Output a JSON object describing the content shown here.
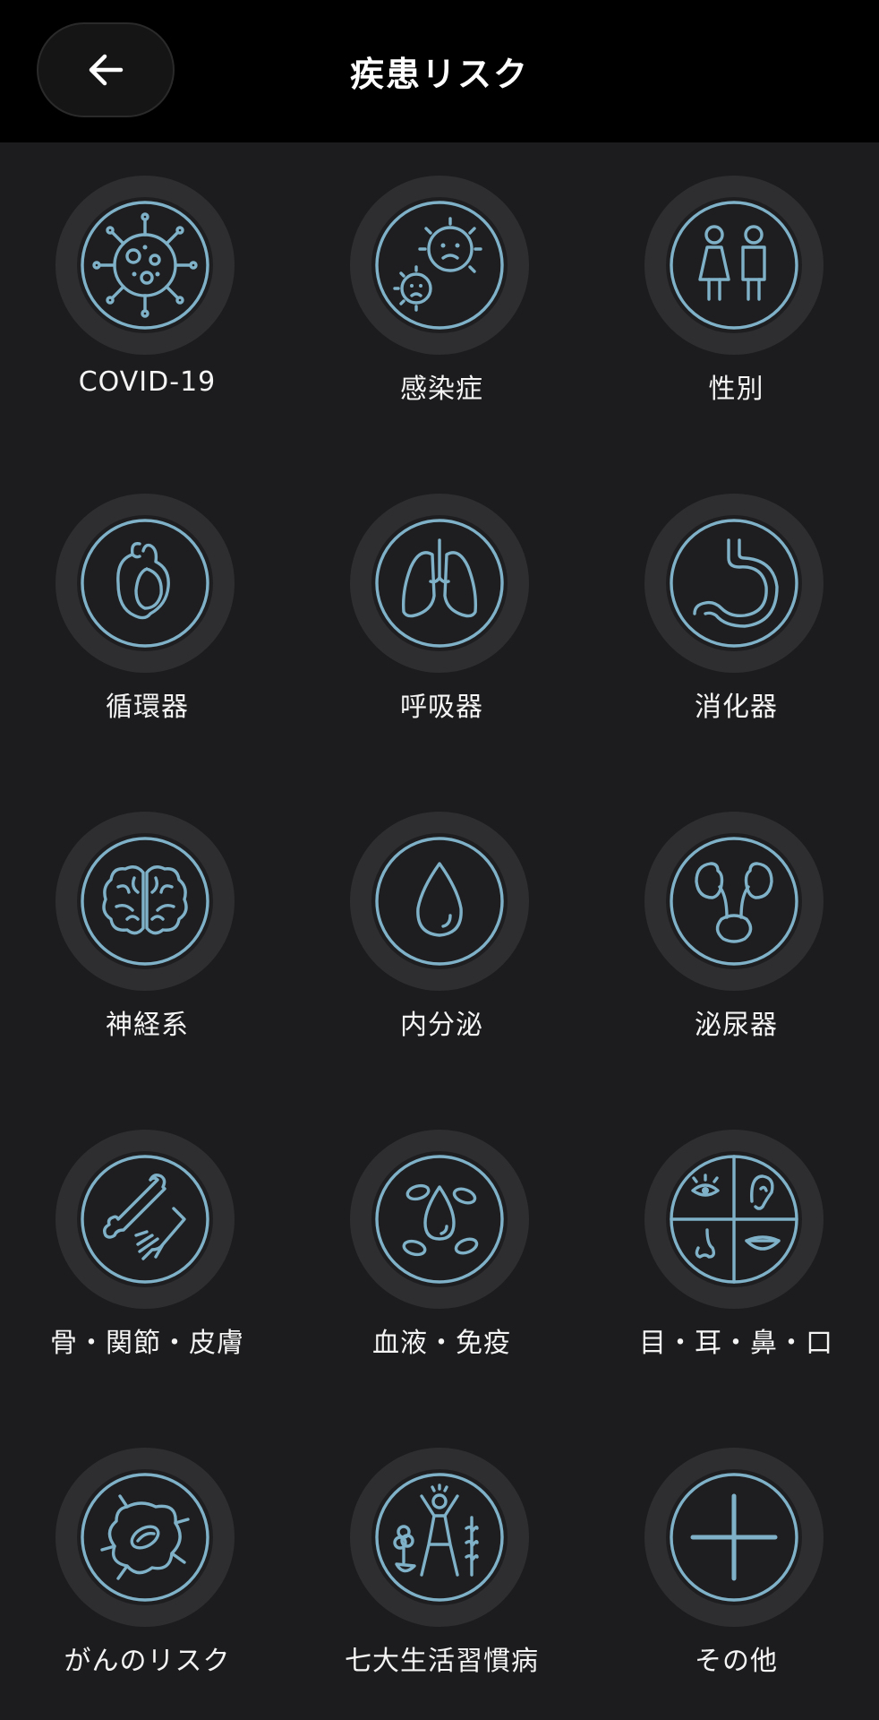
{
  "header": {
    "title": "疾患リスク",
    "back_icon": "arrow-left-icon"
  },
  "accent_color": "#7fb2c8",
  "categories": [
    {
      "label": "COVID-19",
      "icon": "virus-icon"
    },
    {
      "label": "感染症",
      "icon": "germs-icon"
    },
    {
      "label": "性別",
      "icon": "gender-icon"
    },
    {
      "label": "循環器",
      "icon": "heart-icon"
    },
    {
      "label": "呼吸器",
      "icon": "lungs-icon"
    },
    {
      "label": "消化器",
      "icon": "stomach-icon"
    },
    {
      "label": "神経系",
      "icon": "brain-icon"
    },
    {
      "label": "内分泌",
      "icon": "drop-icon"
    },
    {
      "label": "泌尿器",
      "icon": "kidney-icon"
    },
    {
      "label": "骨・関節・皮膚",
      "icon": "bone-skin-icon"
    },
    {
      "label": "血液・免疫",
      "icon": "blood-cells-icon"
    },
    {
      "label": "目・耳・鼻・口",
      "icon": "senses-icon"
    },
    {
      "label": "がんのリスク",
      "icon": "cancer-cell-icon"
    },
    {
      "label": "七大生活習慣病",
      "icon": "lifestyle-icon"
    },
    {
      "label": "その他",
      "icon": "plus-icon"
    }
  ]
}
